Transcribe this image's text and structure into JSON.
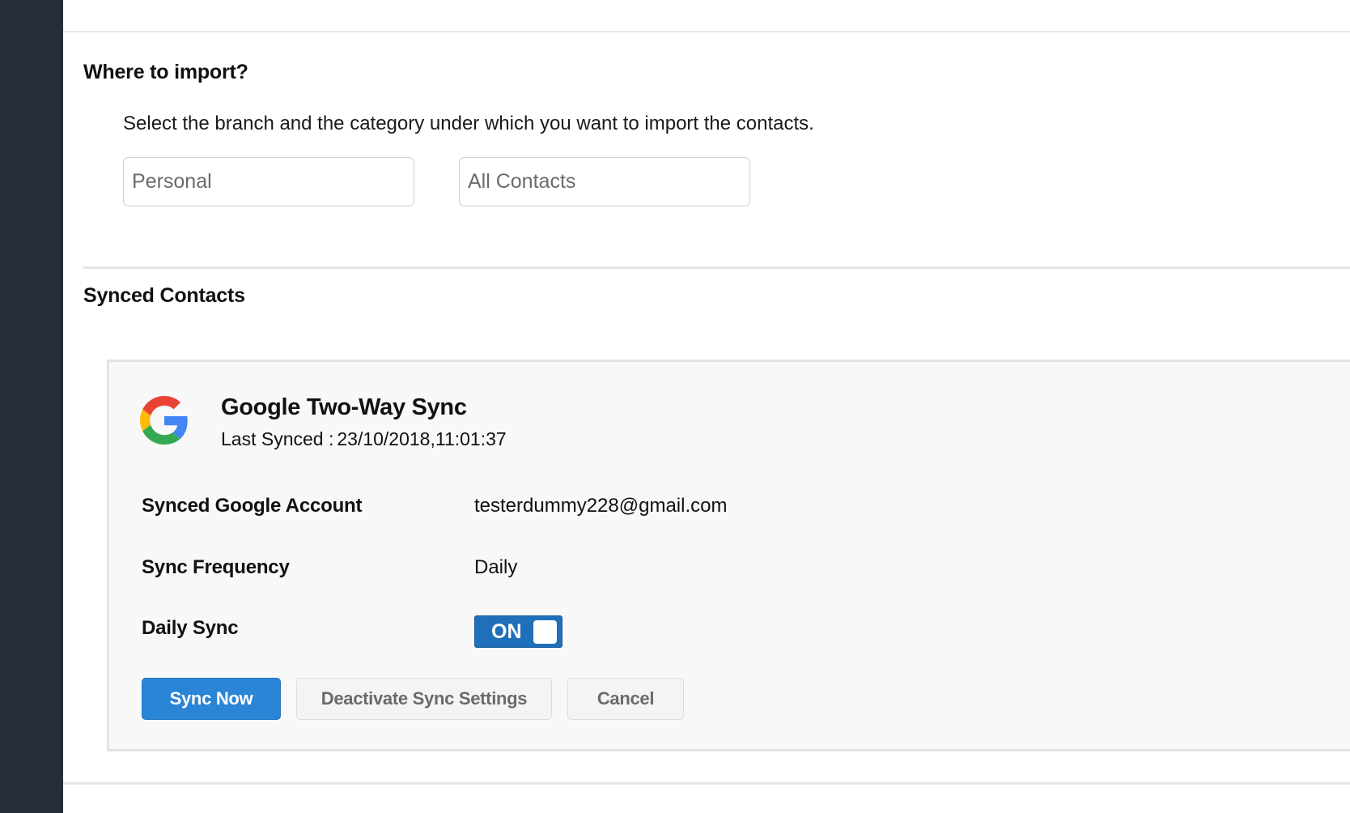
{
  "import_section": {
    "title": "Where to import?",
    "instructions": "Select the branch and the category under which you want to import the contacts.",
    "branch_value": "Personal",
    "category_value": "All Contacts"
  },
  "synced_section": {
    "title": "Synced Contacts",
    "card": {
      "title": "Google Two-Way Sync",
      "last_synced_label": "Last Synced :",
      "last_synced_value": "23/10/2018,11:01:37",
      "account_label": "Synced Google Account",
      "account_value": "testerdummy228@gmail.com",
      "frequency_label": "Sync Frequency",
      "frequency_value": "Daily",
      "daily_sync_label": "Daily Sync",
      "daily_sync_toggle": "ON",
      "sync_now_label": "Sync Now",
      "deactivate_label": "Deactivate Sync Settings",
      "cancel_label": "Cancel"
    }
  },
  "icons": {
    "google_logo": "google-g-icon"
  },
  "colors": {
    "sidebar": "#252d3a",
    "primary_button": "#2b85d6",
    "toggle_on": "#1f6fba",
    "google_blue": "#4285F4",
    "google_red": "#EA4335",
    "google_yellow": "#FBBC05",
    "google_green": "#34A853"
  }
}
